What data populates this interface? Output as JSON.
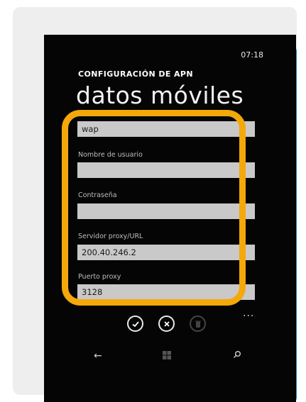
{
  "status": {
    "time": "07:18"
  },
  "page": {
    "header": "CONFIGURACIÓN DE APN",
    "title": "datos móviles"
  },
  "fields": [
    {
      "label": "",
      "value": "wap"
    },
    {
      "label": "Nombre de usuario",
      "value": ""
    },
    {
      "label": "Contraseña",
      "value": ""
    },
    {
      "label": "Servidor proxy/URL",
      "value": "200.40.246.2"
    },
    {
      "label": "Puerto proxy",
      "value": "3128"
    }
  ],
  "appbar": {
    "save_icon": "check-circle-icon",
    "cancel_icon": "x-circle-icon",
    "delete_icon": "trash-icon",
    "more": "..."
  },
  "colors": {
    "highlight": "#f4a80a",
    "background": "#050505",
    "field": "#c9c9c9"
  }
}
